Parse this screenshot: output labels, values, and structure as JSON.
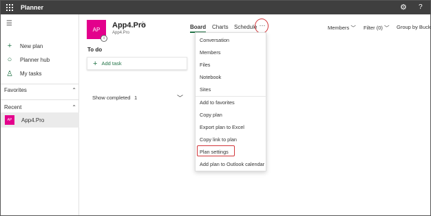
{
  "app": {
    "title": "Planner"
  },
  "header_icons": {
    "settings": "⚙",
    "help": "?"
  },
  "nav": {
    "items": [
      {
        "label": "New plan",
        "icon": "plus-icon"
      },
      {
        "label": "Planner hub",
        "icon": "hub-icon"
      },
      {
        "label": "My tasks",
        "icon": "person-icon"
      }
    ],
    "favorites": "Favorites",
    "recent": "Recent",
    "recent_items": [
      {
        "label": "App4.Pro",
        "initials": "AP"
      }
    ]
  },
  "plan": {
    "initials": "AP",
    "name": "App4.Pro",
    "group": "App4.Pro",
    "info": "i"
  },
  "tabs": [
    {
      "label": "Board",
      "active": true
    },
    {
      "label": "Charts",
      "active": false
    },
    {
      "label": "Schedule",
      "active": false
    }
  ],
  "more": "···",
  "toolbar": {
    "members": "Members",
    "filter": "Filter (0)",
    "group_by": "Group by Bucket"
  },
  "board": {
    "bucket": "To do",
    "add_task": "Add task",
    "show_completed": "Show completed",
    "completed_count": "1"
  },
  "menu": {
    "group1": [
      "Conversation",
      "Members",
      "Files",
      "Notebook",
      "Sites"
    ],
    "group2": [
      "Add to favorites",
      "Copy plan",
      "Export plan to Excel",
      "Copy link to plan",
      "Plan settings",
      "Add plan to Outlook calendar"
    ]
  },
  "colors": {
    "accent": "#217346",
    "plan": "#e3008c",
    "highlight": "#d13438",
    "topbar": "#3f3f3f"
  }
}
